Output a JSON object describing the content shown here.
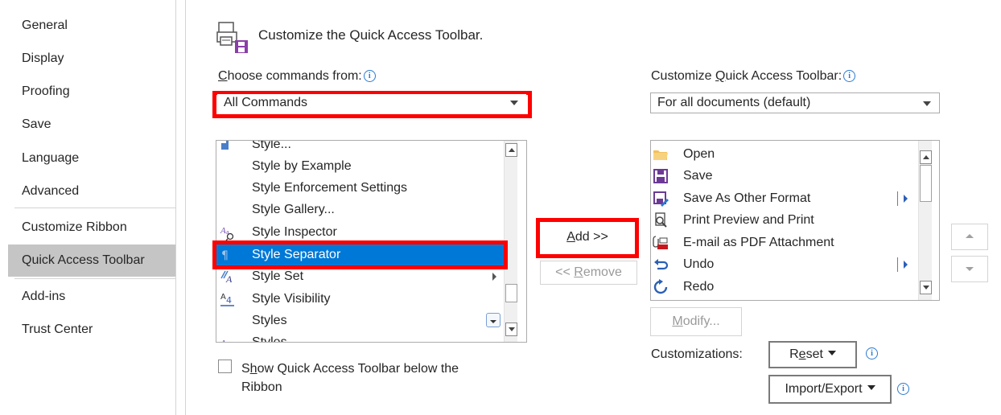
{
  "sidebar": {
    "items": [
      {
        "label": "General"
      },
      {
        "label": "Display"
      },
      {
        "label": "Proofing"
      },
      {
        "label": "Save"
      },
      {
        "label": "Language"
      },
      {
        "label": "Advanced"
      },
      {
        "label": "Customize Ribbon"
      },
      {
        "label": "Quick Access Toolbar"
      },
      {
        "label": "Add-ins"
      },
      {
        "label": "Trust Center"
      }
    ]
  },
  "header": {
    "title": "Customize the Quick Access Toolbar."
  },
  "commands_from": {
    "label_pre": "C",
    "label_rest": "hoose commands from:",
    "selected": "All Commands"
  },
  "customize_qat": {
    "label_pre": "Customize ",
    "label_u": "Q",
    "label_rest": "uick Access Toolbar:",
    "selected": "For all documents (default)"
  },
  "commands_list": {
    "items": [
      {
        "label": "Style...",
        "icon": "style-icon"
      },
      {
        "label": "Style by Example",
        "icon": ""
      },
      {
        "label": "Style Enforcement Settings",
        "icon": ""
      },
      {
        "label": "Style Gallery...",
        "icon": ""
      },
      {
        "label": "Style Inspector",
        "icon": "style-inspector-icon"
      },
      {
        "label": "Style Separator",
        "icon": "style-separator-icon",
        "selected": true
      },
      {
        "label": "Style Set",
        "icon": "style-set-icon",
        "submenu": true
      },
      {
        "label": "Style Visibility",
        "icon": "style-visibility-icon"
      },
      {
        "label": "Styles",
        "icon": "",
        "gallery": true
      },
      {
        "label": "Styles",
        "icon": "styles-icon"
      }
    ]
  },
  "toolbar_list": {
    "items": [
      {
        "label": "Open",
        "icon": "folder-icon"
      },
      {
        "label": "Save",
        "icon": "save-icon"
      },
      {
        "label": "Save As Other Format",
        "icon": "save-as-icon",
        "submenu": true
      },
      {
        "label": "Print Preview and Print",
        "icon": "print-preview-icon"
      },
      {
        "label": "E-mail as PDF Attachment",
        "icon": "pdf-email-icon"
      },
      {
        "label": "Undo",
        "icon": "undo-icon",
        "submenu": true
      },
      {
        "label": "Redo",
        "icon": "redo-icon"
      }
    ]
  },
  "buttons": {
    "add_u": "A",
    "add_rest": "dd >>",
    "remove_pre": "<< ",
    "remove_u": "R",
    "remove_rest": "emove",
    "modify_u": "M",
    "modify_rest": "odify...",
    "reset_pre": "R",
    "reset_u": "e",
    "reset_rest": "set",
    "import_pre": "Import/Export"
  },
  "customizations_label": "Customizations:",
  "show_below": {
    "line1_pre": "S",
    "line1_u": "h",
    "line1_rest": "ow Quick Access Toolbar below the",
    "line2": "Ribbon",
    "checked": false
  },
  "colors": {
    "selection": "#0078d7",
    "highlight_box": "#ff0000",
    "sidebar_selected": "#c5c5c5"
  }
}
